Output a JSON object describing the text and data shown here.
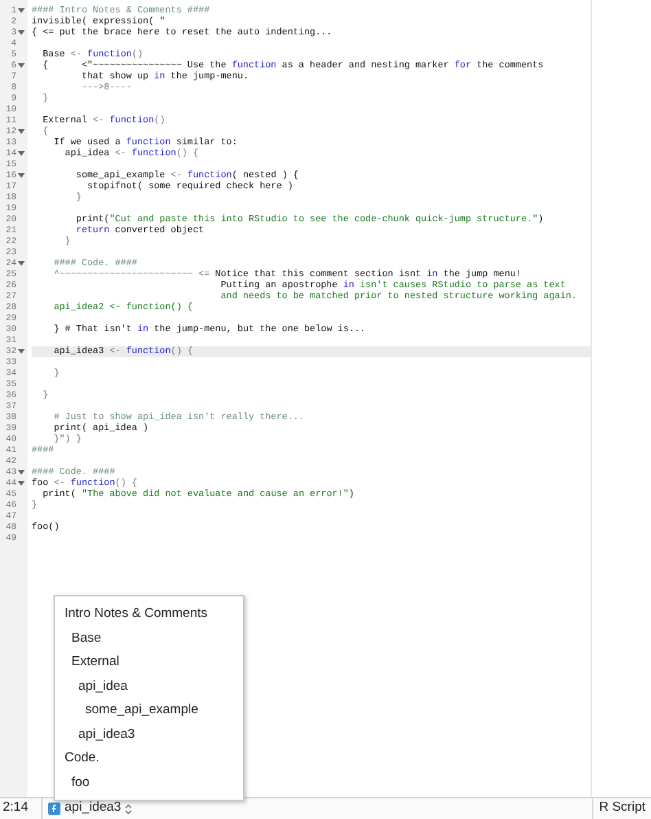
{
  "editor": {
    "lines": [
      {
        "n": "1",
        "fold": true,
        "current": false,
        "tokens": [
          {
            "t": "#### Intro Notes & Comments ####",
            "kind": "comment"
          }
        ]
      },
      {
        "n": "2",
        "fold": false,
        "current": false,
        "tokens": [
          {
            "t": "invisible( expression( \"",
            "kind": "plain"
          }
        ]
      },
      {
        "n": "3",
        "fold": true,
        "current": false,
        "tokens": [
          {
            "t": "{ <= put the brace here to reset the auto indenting...",
            "kind": "plain"
          }
        ]
      },
      {
        "n": "4",
        "fold": false,
        "current": false
      },
      {
        "n": "5",
        "fold": false,
        "current": false,
        "tokens": [
          {
            "t": "  Base ",
            "kind": "plain"
          },
          {
            "t": "<-",
            "kind": "op"
          },
          {
            "t": " function",
            "kind": "keyword"
          },
          {
            "t": "()",
            "kind": "op"
          }
        ]
      },
      {
        "n": "6",
        "fold": true,
        "current": false,
        "tokens": [
          {
            "t": "  {      <\"~~~~~~~~~~~~~~~~ Use the ",
            "kind": "plain"
          },
          {
            "t": "function",
            "kind": "keyword"
          },
          {
            "t": " as a header and nesting marker ",
            "kind": "plain"
          },
          {
            "t": "for",
            "kind": "keyword"
          },
          {
            "t": " the comments",
            "kind": "plain"
          }
        ]
      },
      {
        "n": "7",
        "fold": false,
        "current": false,
        "tokens": [
          {
            "t": "         that show up ",
            "kind": "plain"
          },
          {
            "t": "in",
            "kind": "keyword"
          },
          {
            "t": " the jump-menu.",
            "kind": "plain"
          }
        ]
      },
      {
        "n": "8",
        "fold": false,
        "current": false,
        "tokens": [
          {
            "t": "         --->8----",
            "kind": "op"
          }
        ]
      },
      {
        "n": "9",
        "fold": false,
        "current": false,
        "tokens": [
          {
            "t": "  }",
            "kind": "op"
          }
        ]
      },
      {
        "n": "10",
        "fold": false,
        "current": false
      },
      {
        "n": "11",
        "fold": false,
        "current": false,
        "tokens": [
          {
            "t": "  External ",
            "kind": "plain"
          },
          {
            "t": "<-",
            "kind": "op"
          },
          {
            "t": " function",
            "kind": "keyword"
          },
          {
            "t": "()",
            "kind": "op"
          }
        ]
      },
      {
        "n": "12",
        "fold": true,
        "current": false,
        "tokens": [
          {
            "t": "  {",
            "kind": "op"
          }
        ]
      },
      {
        "n": "13",
        "fold": false,
        "current": false,
        "tokens": [
          {
            "t": "    If we used a ",
            "kind": "plain"
          },
          {
            "t": "function",
            "kind": "keyword"
          },
          {
            "t": " similar to:",
            "kind": "plain"
          }
        ]
      },
      {
        "n": "14",
        "fold": true,
        "current": false,
        "tokens": [
          {
            "t": "      api_idea ",
            "kind": "plain"
          },
          {
            "t": "<-",
            "kind": "op"
          },
          {
            "t": " function",
            "kind": "keyword"
          },
          {
            "t": "() {",
            "kind": "op"
          }
        ]
      },
      {
        "n": "15",
        "fold": false,
        "current": false
      },
      {
        "n": "16",
        "fold": true,
        "current": false,
        "tokens": [
          {
            "t": "        some_api_example ",
            "kind": "plain"
          },
          {
            "t": "<-",
            "kind": "op"
          },
          {
            "t": " function",
            "kind": "keyword"
          },
          {
            "t": "( nested ) {",
            "kind": "plain"
          }
        ]
      },
      {
        "n": "17",
        "fold": false,
        "current": false,
        "tokens": [
          {
            "t": "          stopifnot( some required check here )",
            "kind": "plain"
          }
        ]
      },
      {
        "n": "18",
        "fold": false,
        "current": false,
        "tokens": [
          {
            "t": "        }",
            "kind": "op"
          }
        ]
      },
      {
        "n": "19",
        "fold": false,
        "current": false
      },
      {
        "n": "20",
        "fold": false,
        "current": false,
        "tokens": [
          {
            "t": "        print(",
            "kind": "plain"
          },
          {
            "t": "\"Cut and paste this into RStudio to see the code-chunk quick-jump structure.\"",
            "kind": "string"
          },
          {
            "t": ")",
            "kind": "plain"
          }
        ]
      },
      {
        "n": "21",
        "fold": false,
        "current": false,
        "tokens": [
          {
            "t": "        return",
            "kind": "keyword"
          },
          {
            "t": " converted object",
            "kind": "plain"
          }
        ]
      },
      {
        "n": "22",
        "fold": false,
        "current": false,
        "tokens": [
          {
            "t": "      }",
            "kind": "op"
          }
        ]
      },
      {
        "n": "23",
        "fold": false,
        "current": false
      },
      {
        "n": "24",
        "fold": true,
        "current": false,
        "tokens": [
          {
            "t": "    #### Code. ####",
            "kind": "comment"
          }
        ]
      },
      {
        "n": "25",
        "fold": false,
        "current": false,
        "tokens": [
          {
            "t": "    ^~~~~~~~~~~~~~~~~~~~~~~~~ <= ",
            "kind": "op"
          },
          {
            "t": "Notice that this comment section isnt ",
            "kind": "plain"
          },
          {
            "t": "in",
            "kind": "keyword"
          },
          {
            "t": " the jump menu!",
            "kind": "plain"
          }
        ]
      },
      {
        "n": "26",
        "fold": false,
        "current": false,
        "tokens": [
          {
            "t": "                                  Putting an apostrophe ",
            "kind": "plain"
          },
          {
            "t": "in",
            "kind": "keyword"
          },
          {
            "t": " isn't causes RStudio to parse as text",
            "kind": "string"
          }
        ]
      },
      {
        "n": "27",
        "fold": false,
        "current": false,
        "tokens": [
          {
            "t": "                                  and needs to be matched prior to nested structure working again.",
            "kind": "string"
          }
        ]
      },
      {
        "n": "28",
        "fold": false,
        "current": false,
        "tokens": [
          {
            "t": "    api_idea2 <- function() {",
            "kind": "string"
          }
        ]
      },
      {
        "n": "29",
        "fold": false,
        "current": false
      },
      {
        "n": "30",
        "fold": false,
        "current": false,
        "tokens": [
          {
            "t": "    } # That isn't ",
            "kind": "plain"
          },
          {
            "t": "in",
            "kind": "keyword"
          },
          {
            "t": " the jump-menu, but the one below is...",
            "kind": "plain"
          }
        ]
      },
      {
        "n": "31",
        "fold": false,
        "current": false
      },
      {
        "n": "32",
        "fold": true,
        "current": true,
        "tokens": [
          {
            "t": "    api_idea3 ",
            "kind": "plain"
          },
          {
            "t": "<-",
            "kind": "op"
          },
          {
            "t": " function",
            "kind": "keyword"
          },
          {
            "t": "() {",
            "kind": "op"
          }
        ]
      },
      {
        "n": "33",
        "fold": false,
        "current": false
      },
      {
        "n": "34",
        "fold": false,
        "current": false,
        "tokens": [
          {
            "t": "    }",
            "kind": "op"
          }
        ]
      },
      {
        "n": "35",
        "fold": false,
        "current": false
      },
      {
        "n": "36",
        "fold": false,
        "current": false,
        "tokens": [
          {
            "t": "  }",
            "kind": "op"
          }
        ]
      },
      {
        "n": "37",
        "fold": false,
        "current": false
      },
      {
        "n": "38",
        "fold": false,
        "current": false,
        "tokens": [
          {
            "t": "    # Just to show api_idea isn't really there...",
            "kind": "comment"
          }
        ]
      },
      {
        "n": "39",
        "fold": false,
        "current": false,
        "tokens": [
          {
            "t": "    print( api_idea )",
            "kind": "plain"
          }
        ]
      },
      {
        "n": "40",
        "fold": false,
        "current": false,
        "tokens": [
          {
            "t": "    }\") }",
            "kind": "op"
          }
        ]
      },
      {
        "n": "41",
        "fold": false,
        "current": false,
        "tokens": [
          {
            "t": "####",
            "kind": "comment"
          }
        ]
      },
      {
        "n": "42",
        "fold": false,
        "current": false
      },
      {
        "n": "43",
        "fold": true,
        "current": false,
        "tokens": [
          {
            "t": "#### Code. ####",
            "kind": "comment"
          }
        ]
      },
      {
        "n": "44",
        "fold": true,
        "current": false,
        "tokens": [
          {
            "t": "foo ",
            "kind": "plain"
          },
          {
            "t": "<-",
            "kind": "op"
          },
          {
            "t": " function",
            "kind": "keyword"
          },
          {
            "t": "() {",
            "kind": "op"
          }
        ]
      },
      {
        "n": "45",
        "fold": false,
        "current": false,
        "tokens": [
          {
            "t": "  print( ",
            "kind": "plain"
          },
          {
            "t": "\"The above did not evaluate and cause an error!\"",
            "kind": "string"
          },
          {
            "t": ")",
            "kind": "plain"
          }
        ]
      },
      {
        "n": "46",
        "fold": false,
        "current": false,
        "tokens": [
          {
            "t": "}",
            "kind": "op"
          }
        ]
      },
      {
        "n": "47",
        "fold": false,
        "current": false
      },
      {
        "n": "48",
        "fold": false,
        "current": false,
        "tokens": [
          {
            "t": "foo()",
            "kind": "plain"
          }
        ]
      },
      {
        "n": "49",
        "fold": false,
        "current": false
      }
    ]
  },
  "jump_menu": {
    "items": [
      {
        "label": "Intro Notes & Comments",
        "children": [
          {
            "label": "Base"
          },
          {
            "label": "External",
            "children": [
              {
                "label": "api_idea",
                "children": [
                  {
                    "label": "some_api_example"
                  }
                ]
              },
              {
                "label": "api_idea3"
              }
            ]
          }
        ]
      },
      {
        "label": "Code.",
        "children": [
          {
            "label": "foo"
          }
        ]
      }
    ]
  },
  "status_bar": {
    "position": "2:14",
    "current_section": "api_idea3",
    "file_type": "R Script"
  }
}
